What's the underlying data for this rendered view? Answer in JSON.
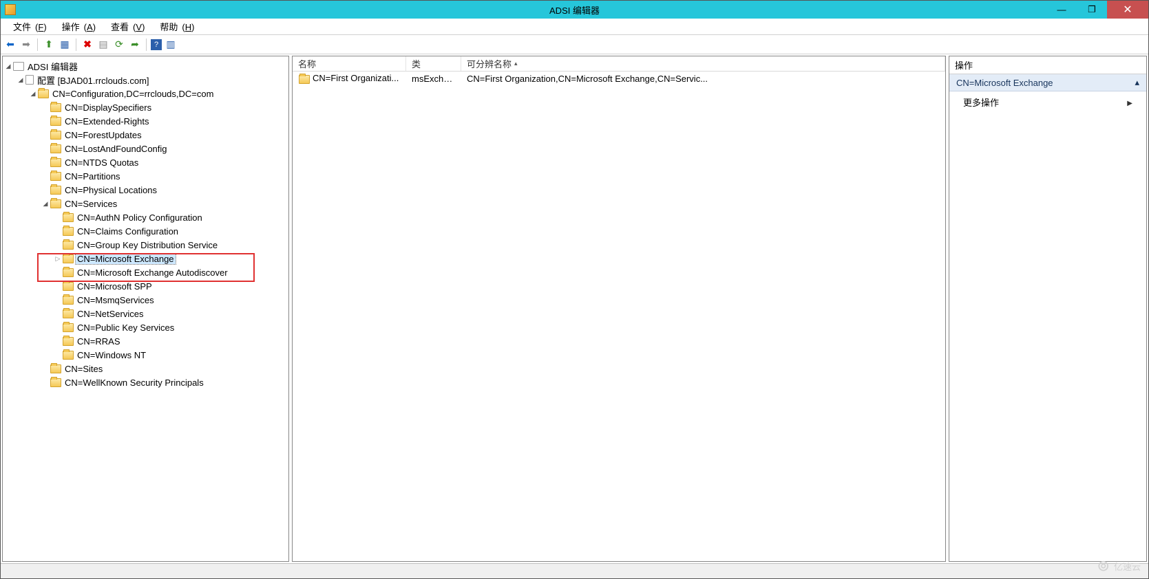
{
  "window": {
    "title": "ADSI 编辑器"
  },
  "menu": {
    "file": {
      "label": "文件",
      "accel": "F"
    },
    "action": {
      "label": "操作",
      "accel": "A"
    },
    "view": {
      "label": "查看",
      "accel": "V"
    },
    "help": {
      "label": "帮助",
      "accel": "H"
    }
  },
  "tree": {
    "root": "ADSI 编辑器",
    "config_node": "配置 [BJAD01.rrclouds.com]",
    "configuration_dn": "CN=Configuration,DC=rrclouds,DC=com",
    "children": {
      "display_specifiers": "CN=DisplaySpecifiers",
      "extended_rights": "CN=Extended-Rights",
      "forest_updates": "CN=ForestUpdates",
      "lost_found": "CN=LostAndFoundConfig",
      "ntds_quotas": "CN=NTDS Quotas",
      "partitions": "CN=Partitions",
      "physical_locations": "CN=Physical Locations",
      "services": "CN=Services",
      "sites": "CN=Sites",
      "wellknown": "CN=WellKnown Security Principals"
    },
    "services_children": {
      "authn": "CN=AuthN Policy Configuration",
      "claims": "CN=Claims Configuration",
      "groupkey": "CN=Group Key Distribution Service",
      "exchange": "CN=Microsoft Exchange",
      "autodiscover": "CN=Microsoft Exchange Autodiscover",
      "spp": "CN=Microsoft SPP",
      "msmq": "CN=MsmqServices",
      "netservices": "CN=NetServices",
      "pki": "CN=Public Key Services",
      "rras": "CN=RRAS",
      "winnt": "CN=Windows NT"
    }
  },
  "list": {
    "headers": {
      "name": "名称",
      "class": "类",
      "dn": "可分辨名称"
    },
    "rows": [
      {
        "name": "CN=First Organizati...",
        "class": "msExchO...",
        "dn": "CN=First Organization,CN=Microsoft Exchange,CN=Servic..."
      }
    ]
  },
  "actions": {
    "title": "操作",
    "section": "CN=Microsoft Exchange",
    "more": "更多操作"
  },
  "watermark": "亿速云"
}
